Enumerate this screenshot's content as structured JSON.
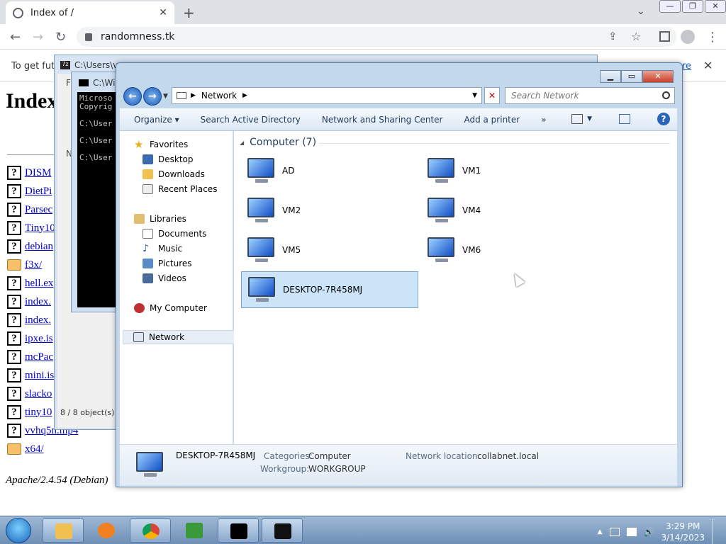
{
  "browser": {
    "tab_title": "Index of /",
    "url": "randomness.tk",
    "infobar_text": "To get futu",
    "infobar_link": "re",
    "win_min": "—",
    "win_max": "❐",
    "win_close": "✕",
    "back": "←",
    "forward": "→",
    "reload": "↻",
    "share": "⇪",
    "star": "☆",
    "menu": "⋮",
    "newtab": "+",
    "tabclose": "✕",
    "tabsearch": "⌄",
    "infobar_close": "✕"
  },
  "page": {
    "heading": "Index",
    "files": [
      {
        "icon": "?",
        "name": "DISM"
      },
      {
        "icon": "?",
        "name": "DietPi"
      },
      {
        "icon": "?",
        "name": "Parsec"
      },
      {
        "icon": "?",
        "name": "Tiny10"
      },
      {
        "icon": "?",
        "name": "debian"
      },
      {
        "icon": "folder",
        "name": "f3x/"
      },
      {
        "icon": "?",
        "name": "hell.ex"
      },
      {
        "icon": "?",
        "name": "index."
      },
      {
        "icon": "?",
        "name": "index."
      },
      {
        "icon": "?",
        "name": "ipxe.is"
      },
      {
        "icon": "?",
        "name": "mcPac"
      },
      {
        "icon": "?",
        "name": "mini.is"
      },
      {
        "icon": "?",
        "name": "slacko"
      },
      {
        "icon": "?",
        "name": "tiny10"
      },
      {
        "icon": "?",
        "name": "vvhq5n.mp4"
      },
      {
        "icon": "folder",
        "name": "x64/"
      }
    ],
    "footer": "Apache/2.4.54 (Debian)"
  },
  "sevenzip": {
    "title": "C:\\Users\\vm",
    "status": "8 / 8 object(s) s",
    "menu_fi": "Fi",
    "col_n": "N"
  },
  "cmd": {
    "title": "C:\\Win",
    "lines": "Microso\nCopyrig\n\nC:\\User\n\nC:\\User\n\nC:\\User"
  },
  "explorer": {
    "address": "Network",
    "search_placeholder": "Search Network",
    "toolbar": {
      "organize": "Organize ▾",
      "search_ad": "Search Active Directory",
      "nsc": "Network and Sharing Center",
      "add_printer": "Add a printer",
      "more": "»"
    },
    "nav": {
      "favorites": "Favorites",
      "desktop": "Desktop",
      "downloads": "Downloads",
      "recent": "Recent Places",
      "libraries": "Libraries",
      "documents": "Documents",
      "music": "Music",
      "pictures": "Pictures",
      "videos": "Videos",
      "mycomputer": "My Computer",
      "network": "Network"
    },
    "group_header": "Computer (7)",
    "computers": [
      "AD",
      "VM1",
      "VM2",
      "VM4",
      "VM5",
      "VM6",
      "DESKTOP-7R458MJ"
    ],
    "details": {
      "name": "DESKTOP-7R458MJ",
      "categories_label": "Categories:",
      "categories_value": "Computer",
      "workgroup_label": "Workgroup:",
      "workgroup_value": "WORKGROUP",
      "netloc_label": "Network location:",
      "netloc_value": "collabnet.local"
    }
  },
  "taskbar": {
    "time": "3:29 PM",
    "date": "3/14/2023",
    "up_arrow": "▲",
    "volume": "🔊"
  }
}
